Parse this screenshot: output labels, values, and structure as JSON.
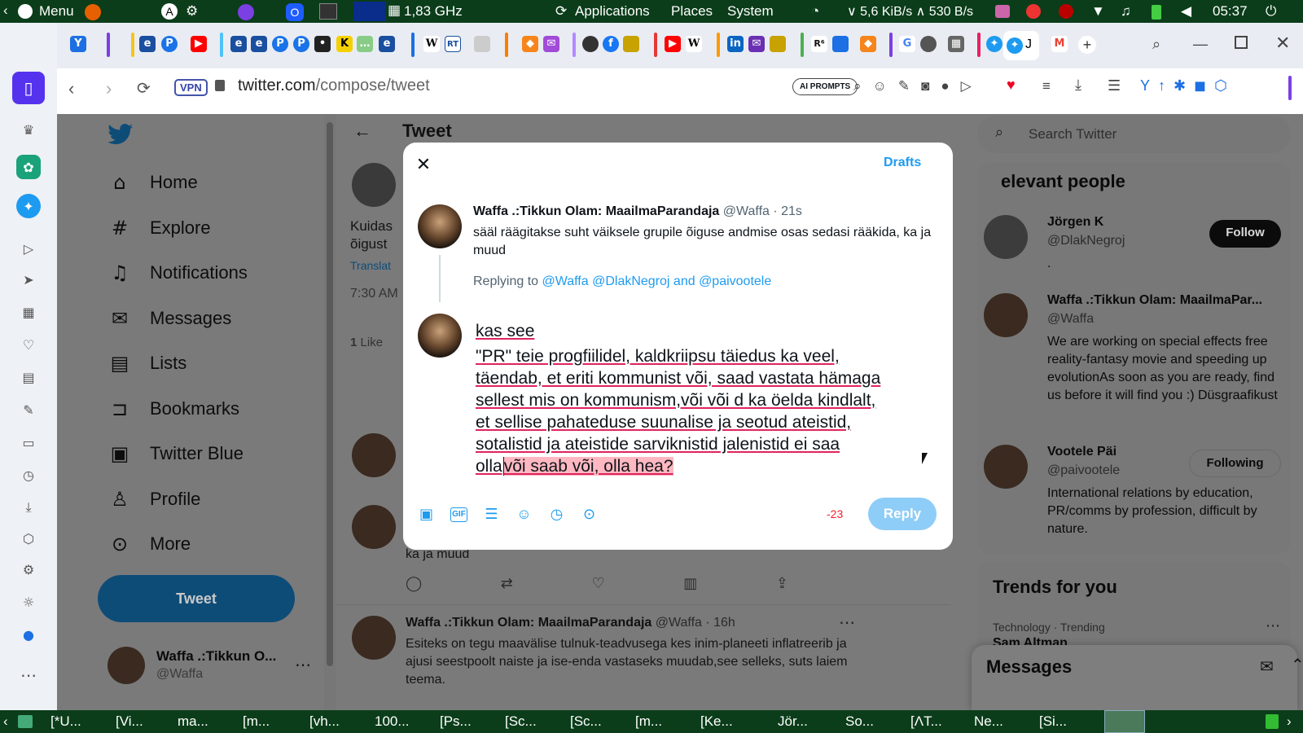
{
  "os_top": {
    "menu_label": "Menu",
    "cpu": "1,83 GHz",
    "applications": "Applications",
    "places": "Places",
    "system": "System",
    "net": "∨ 5,6 KiB/s ∧ 530 B/s",
    "clock": "05:37"
  },
  "browser": {
    "vpn_label": "VPN",
    "url_host": "twitter.com",
    "url_path": "/compose/tweet",
    "ai_prompts": "AI PROMPTS",
    "tab_letters": [
      "W",
      "RT",
      "K",
      "R⁶",
      "G",
      "J"
    ]
  },
  "left_nav": {
    "items": [
      {
        "label": "Home",
        "icon": "home-icon"
      },
      {
        "label": "Explore",
        "icon": "hashtag-icon"
      },
      {
        "label": "Notifications",
        "icon": "bell-icon"
      },
      {
        "label": "Messages",
        "icon": "envelope-icon"
      },
      {
        "label": "Lists",
        "icon": "list-icon"
      },
      {
        "label": "Bookmarks",
        "icon": "bookmark-icon"
      },
      {
        "label": "Twitter Blue",
        "icon": "twitter-blue-icon"
      },
      {
        "label": "Profile",
        "icon": "person-icon"
      },
      {
        "label": "More",
        "icon": "more-circle-icon"
      }
    ],
    "tweet_button": "Tweet",
    "account_name": "Waffa .:Tikkun O...",
    "account_handle": "@Waffa"
  },
  "main": {
    "header": "Tweet",
    "partial_text_1": "Kuidas",
    "partial_text_2": "õigust",
    "translate": "Translat",
    "time": "7:30 AM",
    "likes_count": "1",
    "likes_label": "Like",
    "reply_tail": "ka ja muud",
    "bottom_tweet": {
      "name": "Waffa .:Tikkun Olam: MaailmaParandaja",
      "handle": "@Waffa · 16h",
      "text": "Esiteks on tegu maavälise tulnuk-teadvusega kes inim-planeeti inflatreerib ja ajusi seestpoolt naiste ja ise-enda vastaseks muudab,see selleks, suts laiem teema."
    }
  },
  "right": {
    "search_placeholder": "Search Twitter",
    "relevant_title": "elevant people",
    "people": [
      {
        "name": "Jörgen K",
        "handle": "@DlakNegroj",
        "bio": ".",
        "button": "Follow"
      },
      {
        "name": "Waffa .:Tikkun Olam: MaailmaPar...",
        "handle": "@Waffa",
        "bio": "We are working on special effects free reality-fantasy movie and speeding up evolutionAs soon as you are ready, find us before it will find you :) Düsgraafikust",
        "button": ""
      },
      {
        "name": "Vootele Päi",
        "handle": "@paivootele",
        "bio": "International relations by education, PR/comms by profession, difficult by nature.",
        "button": "Following"
      }
    ],
    "trends_title": "Trends for you",
    "trend_meta": "Technology · Trending",
    "trend_name": "Sam Altman",
    "messages_title": "Messages"
  },
  "compose": {
    "drafts": "Drafts",
    "quoted_name": "Waffa .:Tikkun Olam: MaailmaParandaja",
    "quoted_handle": "@Waffa · 21s",
    "quoted_text": "sääl räägitakse suht väiksele grupile õiguse andmise osas sedasi rääkida, ka ja muud",
    "replying_prefix": "Replying to",
    "replying_users": "@Waffa @DlakNegroj and @paivootele",
    "line1": "kas see",
    "line2": "\"PR\" teie progfiilidel, kaldkriipsu täiedus ka veel,",
    "line3": "täendab, et eriti kommunist või, saad vastata hämaga",
    "line4": "sellest mis on kommunism,või või d ka öelda kindlalt,",
    "line5": "et sellise pahateduse suunalise ja seotud ateistid,",
    "line6": "sotalistid ja ateistide sarviknistid jalenistid ei saa",
    "line7_start": "olla",
    "line7_over": "või saab või, olla hea?",
    "char_count": "-23",
    "reply_button": "Reply"
  },
  "taskbar": {
    "items": [
      "[*U...",
      "[Vi...",
      "ma...",
      "[m...",
      "[vh...",
      "100...",
      "[Ps...",
      "[Sc...",
      "[Sc...",
      "[m...",
      "[Ke...",
      "Jör...",
      "So...",
      "[ΛT...",
      "Ne...",
      "[Si..."
    ]
  },
  "colors": {
    "twitter_blue": "#1d9bf0",
    "os_panel": "#0b3d1a",
    "overlay": "#808080",
    "reply_disabled": "#8ecdf7",
    "over_limit": "#f4212e"
  }
}
